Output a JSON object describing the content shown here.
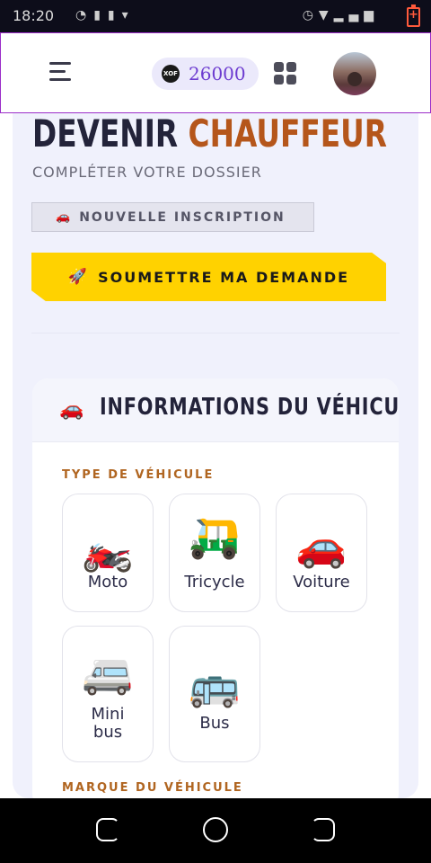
{
  "status_bar": {
    "time": "18:20",
    "left_icons": [
      "app-icon",
      "app-icon",
      "app-icon",
      "dot"
    ],
    "right_icons": [
      "alarm-icon",
      "wifi-icon",
      "signal-icon",
      "signal-icon"
    ],
    "battery_state": "charging"
  },
  "header": {
    "balance_currency": "XOF",
    "balance_amount": "26000"
  },
  "page": {
    "title_part1": "DEVENIR",
    "title_part2": "CHAUFFEUR",
    "subtitle": "COMPLÉTER VOTRE DOSSIER",
    "tag_icon": "🚗",
    "tag_label": "NOUVELLE INSCRIPTION",
    "submit_icon": "🚀",
    "submit_label": "SOUMETTRE MA DEMANDE"
  },
  "vehicle_card": {
    "icon": "🚗",
    "title": "INFORMATIONS DU VÉHICULE",
    "type_label": "TYPE DE VÉHICULE",
    "brand_label": "MARQUE DU VÉHICULE",
    "options": [
      {
        "emoji": "🏍️",
        "label": "Moto"
      },
      {
        "emoji": "🛺",
        "label": "Tricycle"
      },
      {
        "emoji": "🚗",
        "label": "Voiture"
      },
      {
        "emoji": "🚐",
        "label": "Mini bus"
      },
      {
        "emoji": "🚌",
        "label": "Bus"
      }
    ]
  },
  "colors": {
    "accent_orange": "#b5561b",
    "submit_yellow": "#ffd200",
    "balance_purple": "#6c3bd0",
    "header_border": "#9b2ec9"
  }
}
